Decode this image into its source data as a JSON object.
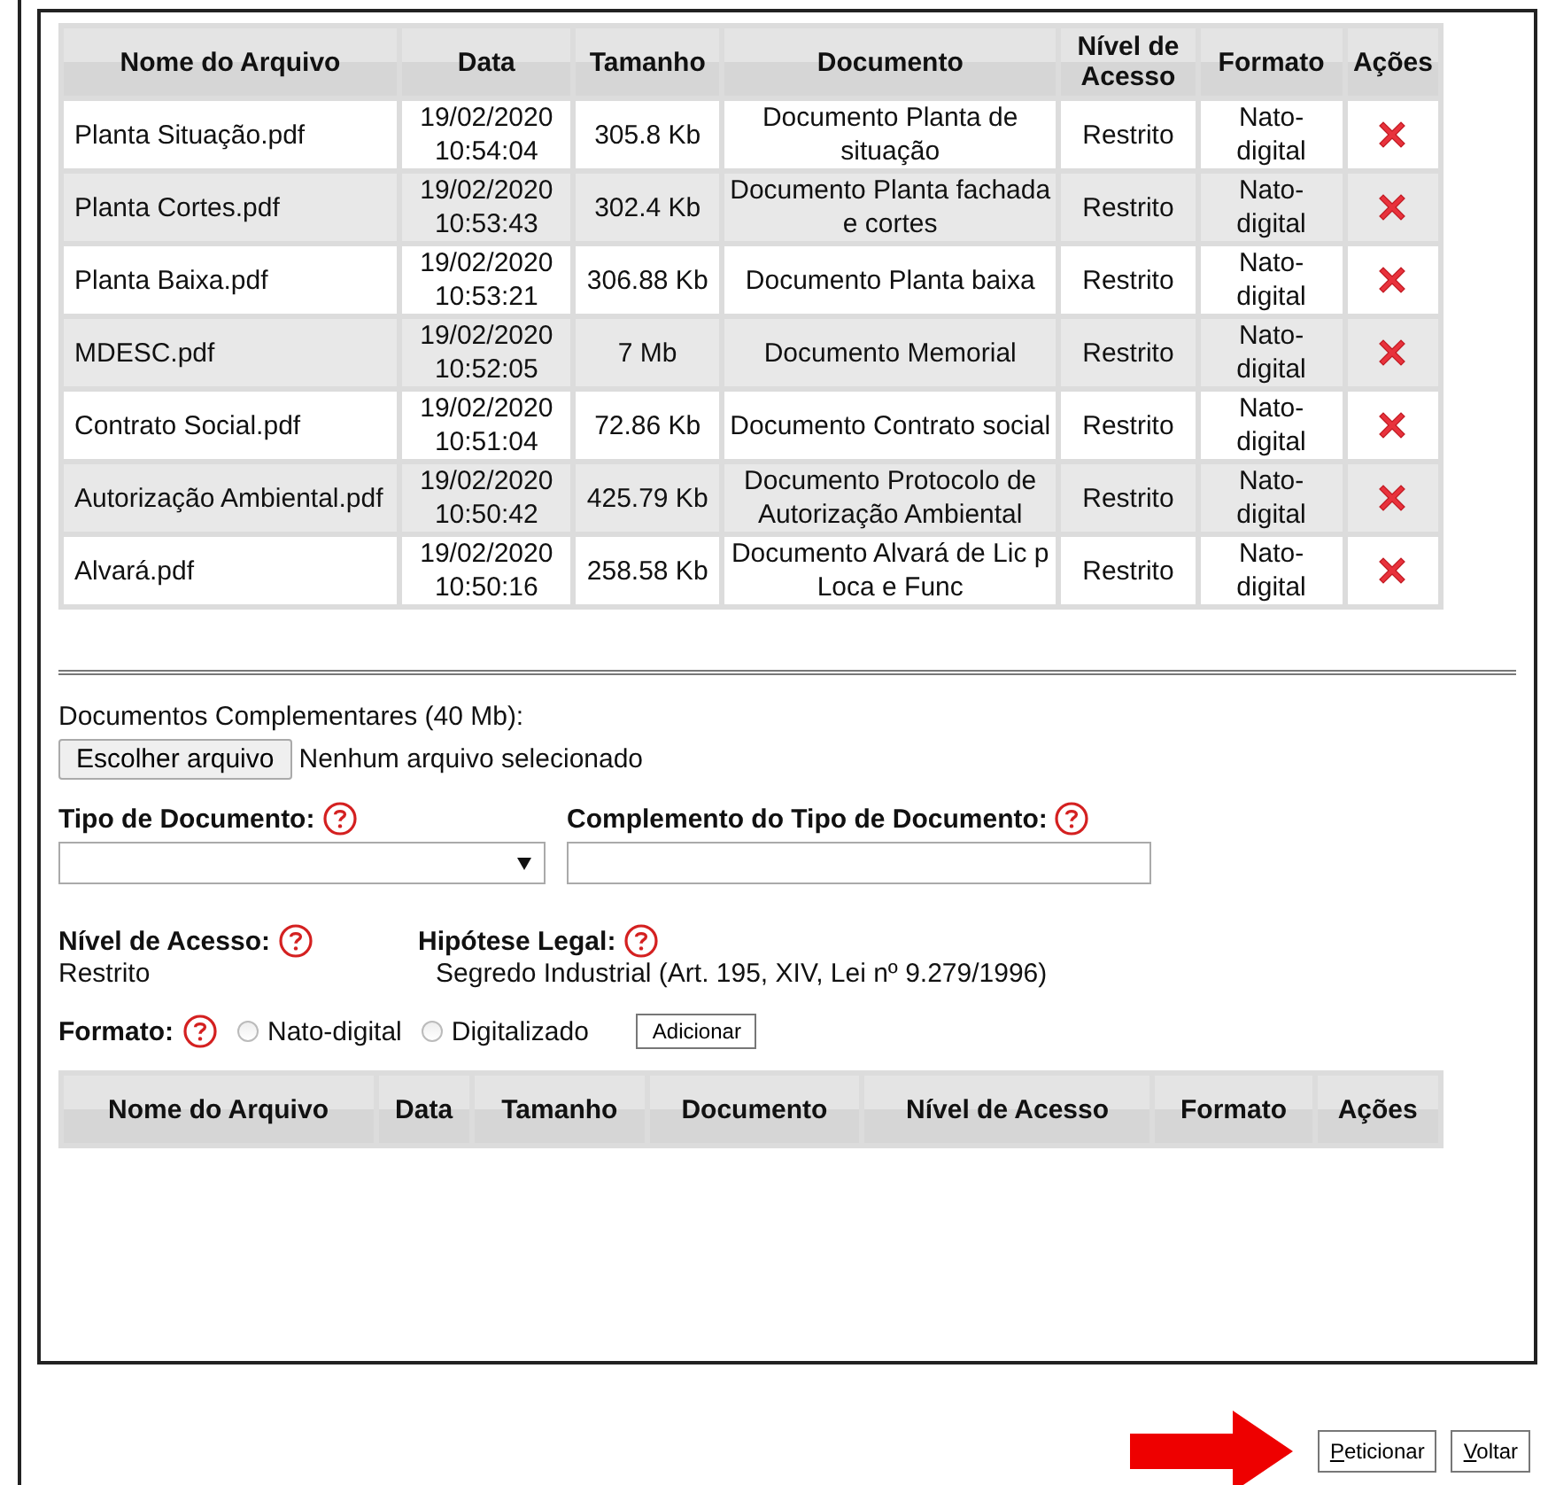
{
  "files_table": {
    "columns": [
      "Nome do Arquivo",
      "Data",
      "Tamanho",
      "Documento",
      "Nível de Acesso",
      "Formato",
      "Ações"
    ],
    "rows": [
      {
        "name": "Planta Situação.pdf",
        "date": "19/02/2020 10:54:04",
        "size": "305.8 Kb",
        "document": "Documento Planta de situação",
        "access": "Restrito",
        "format": "Nato-digital"
      },
      {
        "name": "Planta Cortes.pdf",
        "date": "19/02/2020 10:53:43",
        "size": "302.4 Kb",
        "document": "Documento Planta fachada e cortes",
        "access": "Restrito",
        "format": "Nato-digital"
      },
      {
        "name": "Planta Baixa.pdf",
        "date": "19/02/2020 10:53:21",
        "size": "306.88 Kb",
        "document": "Documento Planta baixa",
        "access": "Restrito",
        "format": "Nato-digital"
      },
      {
        "name": "MDESC.pdf",
        "date": "19/02/2020 10:52:05",
        "size": "7 Mb",
        "document": "Documento Memorial",
        "access": "Restrito",
        "format": "Nato-digital"
      },
      {
        "name": "Contrato Social.pdf",
        "date": "19/02/2020 10:51:04",
        "size": "72.86 Kb",
        "document": "Documento Contrato social",
        "access": "Restrito",
        "format": "Nato-digital"
      },
      {
        "name": "Autorização Ambiental.pdf",
        "date": "19/02/2020 10:50:42",
        "size": "425.79 Kb",
        "document": "Documento Protocolo de Autorização Ambiental",
        "access": "Restrito",
        "format": "Nato-digital"
      },
      {
        "name": "Alvará.pdf",
        "date": "19/02/2020 10:50:16",
        "size": "258.58 Kb",
        "document": "Documento Alvará de Lic p Loca e Func",
        "access": "Restrito",
        "format": "Nato-digital"
      }
    ]
  },
  "complementary": {
    "label": "Documentos Complementares (40 Mb):",
    "choose_button": "Escolher arquivo",
    "file_status": "Nenhum arquivo selecionado",
    "document_type_label": "Tipo de Documento:",
    "complement_label": "Complemento do Tipo de Documento:",
    "access_label": "Nível de Acesso:",
    "access_value": "Restrito",
    "legal_label": "Hipótese Legal:",
    "legal_value": "Segredo Industrial (Art. 195, XIV, Lei nº 9.279/1996)",
    "format_label": "Formato:",
    "format_options": [
      {
        "label": "Nato-digital",
        "selected": false
      },
      {
        "label": "Digitalizado",
        "selected": false
      }
    ],
    "add_button": "Adicionar"
  },
  "complementary_table": {
    "columns": [
      "Nome do Arquivo",
      "Data",
      "Tamanho",
      "Documento",
      "Nível de Acesso",
      "Formato",
      "Ações"
    ]
  },
  "buttons": [
    "Peticionar",
    "Voltar"
  ]
}
